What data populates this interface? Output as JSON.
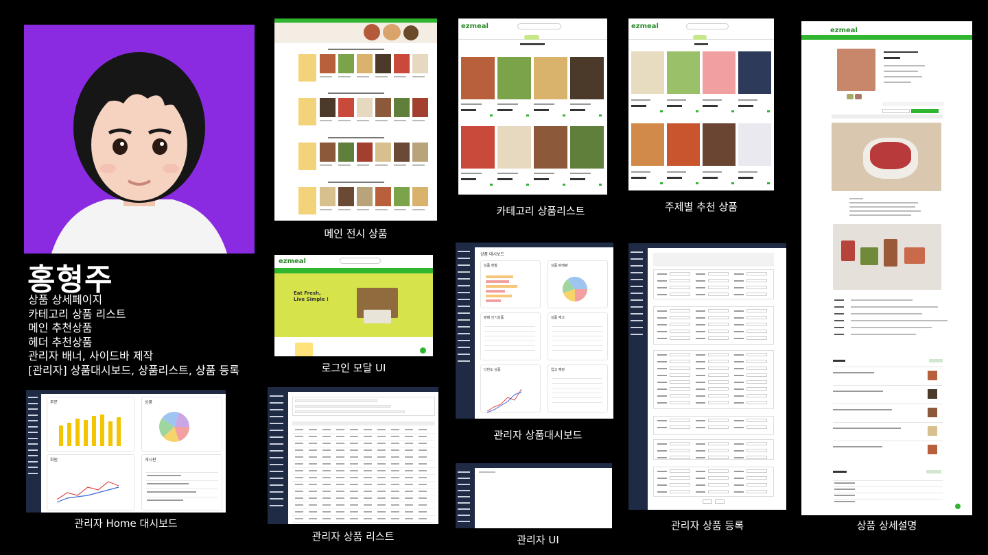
{
  "profile": {
    "name": "홍형주",
    "roles": [
      "상품 상세페이지",
      "카테고리 상품 리스트",
      "메인 추천상품",
      "헤더 추천상품",
      "관리자 배너, 사이드바 제작",
      "[관리자] 상품대시보드, 상품리스트, 상품 등록"
    ],
    "avatar_bg": "#8a2be2"
  },
  "brand": {
    "logo": "ezmeal",
    "accent": "#2fb52f"
  },
  "captions": {
    "main_display": "메인 전시 상품",
    "login_modal": "로그인  모달 UI",
    "category_list": "카테고리 상품리스트",
    "theme_recommend": "주제별 추천 상품",
    "product_detail": "상품 상세설명",
    "admin_home": "관리자 Home 대시보드",
    "admin_product_list": "관리자 상품 리스트",
    "admin_dashboard": "관리자 상품대시보드",
    "admin_ui": "관리자 UI",
    "admin_register": "관리자 상품 등록"
  },
  "login_banner": {
    "headline1": "Eat Fresh,",
    "headline2": "Live Simple !"
  },
  "admin_home": {
    "card_order": "주문",
    "card_product": "상품",
    "card_member": "회원",
    "card_board": "게시판"
  },
  "admin_dashboard": {
    "title": "상품 대시보드",
    "cards": [
      "상품 현황",
      "상품 판매량",
      "판매 인기상품",
      "상품 재고",
      "다빈도 상품",
      "입고 예정"
    ]
  },
  "colors": {
    "sidebar": "#1f2a44",
    "bar_yellow": "#f2c500",
    "line_red": "#e04646",
    "line_blue": "#3b66d6"
  }
}
